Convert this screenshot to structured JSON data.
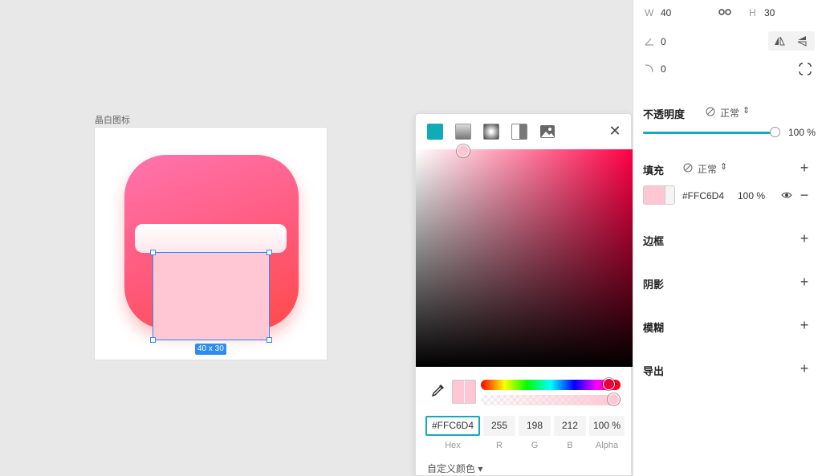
{
  "canvas": {
    "artboard_label": "晶白图标",
    "selection_size": "40 x 30"
  },
  "picker": {
    "fill_types": [
      "solid-fill-icon",
      "linear-gradient-icon",
      "radial-gradient-icon",
      "angular-gradient-icon",
      "image-fill-icon"
    ],
    "close": "✕",
    "hex": "#FFC6D4",
    "r": "255",
    "g": "198",
    "b": "212",
    "alpha": "100 %",
    "labels": {
      "hex": "Hex",
      "r": "R",
      "g": "G",
      "b": "B",
      "alpha": "Alpha"
    },
    "custom_color": "自定义颜色 ▾",
    "colors": {
      "hue": "#ff0044",
      "accent": "#12a9b9"
    }
  },
  "panel": {
    "w_label": "W",
    "w_value": "40",
    "h_label": "H",
    "h_value": "30",
    "rotation_value": "0",
    "radius_value": "0",
    "opacity": {
      "title": "不透明度",
      "blend": "正常",
      "value": "100 %",
      "level": 1.0
    },
    "fill": {
      "title": "填充",
      "blend": "正常",
      "hex": "#FFC6D4",
      "opacity": "100 %"
    },
    "border": {
      "title": "边框"
    },
    "shadow": {
      "title": "阴影"
    },
    "blur": {
      "title": "模糊"
    },
    "export": {
      "title": "导出"
    }
  }
}
